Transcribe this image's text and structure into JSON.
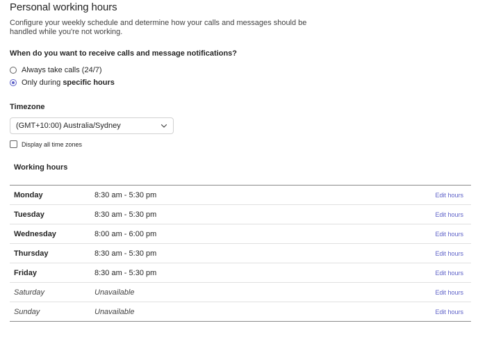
{
  "page": {
    "title": "Personal working hours",
    "description": "Configure your weekly schedule and determine how your calls and messages should be handled while you're not working."
  },
  "notifications": {
    "question": "When do you want to receive calls and message notifications?",
    "options": [
      {
        "label": "Always take calls (24/7)",
        "selected": false
      },
      {
        "label_prefix": "Only during ",
        "label_bold": "specific hours",
        "selected": true
      }
    ]
  },
  "timezone": {
    "label": "Timezone",
    "selected": "(GMT+10:00) Australia/Sydney",
    "display_all_label": "Display all time zones",
    "display_all_checked": false
  },
  "working_hours": {
    "label": "Working hours",
    "edit_label": "Edit hours",
    "days": [
      {
        "day": "Monday",
        "hours": "8:30 am - 5:30 pm",
        "available": true
      },
      {
        "day": "Tuesday",
        "hours": "8:30 am - 5:30 pm",
        "available": true
      },
      {
        "day": "Wednesday",
        "hours": "8:00 am - 6:00 pm",
        "available": true
      },
      {
        "day": "Thursday",
        "hours": "8:30 am - 5:30 pm",
        "available": true
      },
      {
        "day": "Friday",
        "hours": "8:30 am - 5:30 pm",
        "available": true
      },
      {
        "day": "Saturday",
        "hours": "Unavailable",
        "available": false
      },
      {
        "day": "Sunday",
        "hours": "Unavailable",
        "available": false
      }
    ]
  },
  "colors": {
    "accent": "#5b5fc7",
    "text": "#242424",
    "border": "#d1d1d1"
  }
}
